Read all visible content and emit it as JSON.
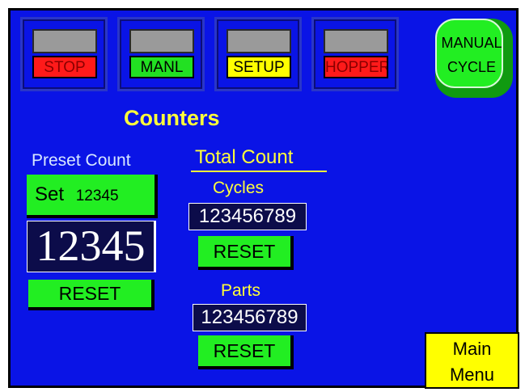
{
  "status_lights": [
    {
      "label": "STOP",
      "color": "#ff1a1a"
    },
    {
      "label": "MANL",
      "color": "#22e022"
    },
    {
      "label": "SETUP",
      "color": "#ffff00"
    },
    {
      "label": "HOPPER",
      "color": "#ff1a1a"
    }
  ],
  "manual_cycle": {
    "line1": "MANUAL",
    "line2": "CYCLE"
  },
  "page_title": "Counters",
  "preset": {
    "heading": "Preset Count",
    "set_button_label": "Set",
    "set_button_value": "12345",
    "display_value": "12345",
    "reset_label": "RESET"
  },
  "total": {
    "heading": "Total Count",
    "cycles": {
      "label": "Cycles",
      "value": "123456789",
      "reset_label": "RESET"
    },
    "parts": {
      "label": "Parts",
      "value": "123456789",
      "reset_label": "RESET"
    }
  },
  "main_menu": {
    "line1": "Main",
    "line2": "Menu"
  },
  "colors": {
    "background": "#0a14e6",
    "accent_yellow": "#ffff3a",
    "button_green": "#22ee22"
  }
}
